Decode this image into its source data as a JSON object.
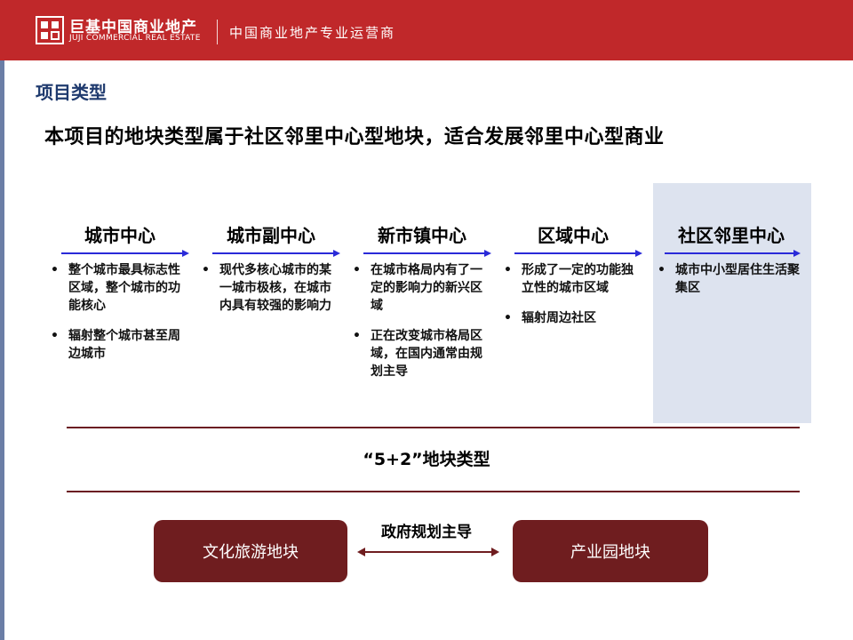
{
  "header": {
    "logo_cn": "巨基中国商业地产",
    "logo_en": "JUJI COMMERCIAL REAL ESTATE",
    "tagline": "中国商业地产专业运营商",
    "bg_color": "#c0282a"
  },
  "section_title": "项目类型",
  "headline": "本项目的地块类型属于社区邻里中心型地块，适合发展邻里中心型商业",
  "columns": [
    {
      "title": "城市中心",
      "bullets": [
        "整个城市最具标志性区域，整个城市的功能核心",
        "辐射整个城市甚至周边城市"
      ]
    },
    {
      "title": "城市副中心",
      "bullets": [
        "现代多核心城市的某一城市极核，在城市内具有较强的影响力"
      ]
    },
    {
      "title": "新市镇中心",
      "bullets": [
        "在城市格局内有了一定的影响力的新兴区域",
        "正在改变城市格局区域，在国内通常由规划主导"
      ]
    },
    {
      "title": "区域中心",
      "bullets": [
        "形成了一定的功能独立性的城市区域",
        "辐射周边社区"
      ]
    },
    {
      "title": "社区邻里中心",
      "bullets": [
        "城市中小型居住生活聚集区"
      ],
      "highlighted": true
    }
  ],
  "bullet_glyph": "•",
  "mid_label": "“5+2”地块类型",
  "bottom": {
    "left_block": "文化旅游地块",
    "right_block": "产业园地块",
    "center_label": "政府规划主导",
    "block_color": "#6f1d1f"
  },
  "colors": {
    "arrow": "#2a2ad8",
    "highlight_bg": "#dde3ef",
    "title_blue": "#1f3a6e",
    "rule": "#6b1e22"
  }
}
